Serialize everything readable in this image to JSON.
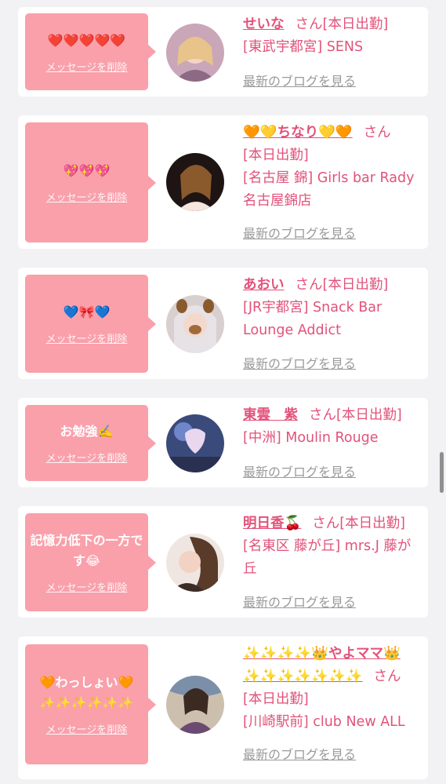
{
  "colors": {
    "accent": "#e2527a",
    "bubble": "#f9a0ab",
    "background": "#f2f2f4",
    "muted": "#9a9a9a"
  },
  "entries": [
    {
      "message": "❤️❤️❤️❤️❤️",
      "delete_label": "メッセージを削除",
      "name": "せいな",
      "san": "さん",
      "status": "[本日出勤]",
      "shop": "[東武宇都宮] SENS",
      "blog_label": "最新のブログを見る",
      "avatar_icon": "profile-photo"
    },
    {
      "message": "💖💖💖",
      "delete_label": "メッセージを削除",
      "name": "🧡💛ちなり💛🧡",
      "san": "さん",
      "status": "[本日出勤]",
      "shop": "[名古屋 錦] Girls bar Rady 名古屋錦店",
      "blog_label": "最新のブログを見る",
      "avatar_icon": "profile-photo"
    },
    {
      "message": "💙🎀💙",
      "delete_label": "メッセージを削除",
      "name": "あおい",
      "san": "さん",
      "status": "[本日出勤]",
      "shop": "[JR宇都宮] Snack Bar Lounge Addict",
      "blog_label": "最新のブログを見る",
      "avatar_icon": "profile-photo"
    },
    {
      "message": "お勉強✍️",
      "delete_label": "メッセージを削除",
      "name": "東雲　紫",
      "san": "さん",
      "status": "[本日出勤]",
      "shop": "[中洲] Moulin Rouge",
      "blog_label": "最新のブログを見る",
      "avatar_icon": "profile-photo"
    },
    {
      "message": "記憶力低下の一方です😂",
      "delete_label": "メッセージを削除",
      "name": "明日香🍒",
      "san": "さん",
      "status": "[本日出勤]",
      "shop": "[名東区 藤が丘] mrs.J 藤が丘",
      "blog_label": "最新のブログを見る",
      "avatar_icon": "profile-photo"
    },
    {
      "message": "🧡わっしょい🧡 ✨✨✨✨✨✨",
      "delete_label": "メッセージを削除",
      "name": "✨✨✨✨👑やよママ👑✨✨✨✨✨✨✨",
      "san": "さん",
      "status": "[本日出勤]",
      "shop": "[川崎駅前] club New ALL",
      "blog_label": "最新のブログを見る",
      "avatar_icon": "profile-photo"
    }
  ]
}
